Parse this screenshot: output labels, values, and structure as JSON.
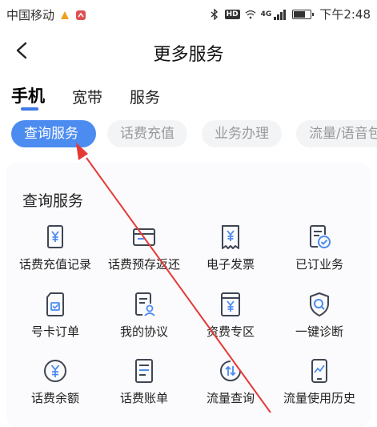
{
  "status_bar": {
    "carrier": "中国移动",
    "time": "下午2:48",
    "hd": "HD",
    "net": "4G"
  },
  "header": {
    "title": "更多服务",
    "back_icon": "chevron-left-icon"
  },
  "category_tabs": [
    {
      "label": "手机",
      "active": true
    },
    {
      "label": "宽带",
      "active": false
    },
    {
      "label": "服务",
      "active": false
    }
  ],
  "filter_pills": [
    {
      "label": "查询服务",
      "active": true
    },
    {
      "label": "话费充值",
      "active": false
    },
    {
      "label": "业务办理",
      "active": false
    },
    {
      "label": "流量/语音包",
      "active": false
    }
  ],
  "section": {
    "title": "查询服务"
  },
  "services": [
    {
      "label": "话费充值记录",
      "icon": "recharge-record-icon"
    },
    {
      "label": "话费预存返还",
      "icon": "card-return-icon"
    },
    {
      "label": "电子发票",
      "icon": "invoice-icon"
    },
    {
      "label": "已订业务",
      "icon": "subscribed-check-icon"
    },
    {
      "label": "号卡订单",
      "icon": "sim-order-icon"
    },
    {
      "label": "我的协议",
      "icon": "agreement-icon"
    },
    {
      "label": "资费专区",
      "icon": "tariff-icon"
    },
    {
      "label": "一键诊断",
      "icon": "diagnose-icon"
    },
    {
      "label": "话费余额",
      "icon": "balance-icon"
    },
    {
      "label": "话费账单",
      "icon": "bill-icon"
    },
    {
      "label": "流量查询",
      "icon": "data-query-icon"
    },
    {
      "label": "流量使用历史",
      "icon": "usage-history-icon"
    }
  ],
  "colors": {
    "accent": "#4c8cf0",
    "annotation": "#e53935",
    "icon_stroke": "#3f4654"
  }
}
